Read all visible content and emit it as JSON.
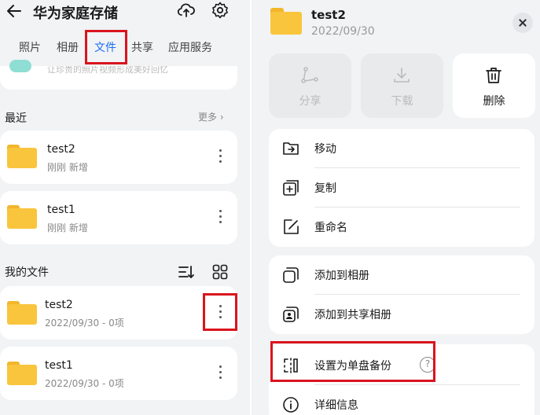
{
  "header": {
    "title": "华为家庭存储"
  },
  "tabs": [
    {
      "label": "照片",
      "active": false
    },
    {
      "label": "相册",
      "active": false
    },
    {
      "label": "文件",
      "active": true
    },
    {
      "label": "共享",
      "active": false
    },
    {
      "label": "应用服务",
      "active": false
    }
  ],
  "banner": {
    "text": "让珍贵的照片视频形成美好回忆"
  },
  "recent": {
    "title": "最近",
    "more_label": "更多",
    "items": [
      {
        "name": "test2",
        "meta": "刚刚 新增"
      },
      {
        "name": "test1",
        "meta": "刚刚 新增"
      }
    ]
  },
  "my_files": {
    "title": "我的文件",
    "items": [
      {
        "name": "test2",
        "meta": "2022/09/30 - 0项"
      },
      {
        "name": "test1",
        "meta": "2022/09/30 - 0项"
      }
    ]
  },
  "sheet": {
    "title": "test2",
    "date": "2022/09/30",
    "actions": [
      {
        "label": "分享",
        "enabled": false
      },
      {
        "label": "下载",
        "enabled": false
      },
      {
        "label": "删除",
        "enabled": true
      }
    ],
    "menu_group_1": [
      {
        "label": "移动"
      },
      {
        "label": "复制"
      },
      {
        "label": "重命名"
      }
    ],
    "menu_group_2": [
      {
        "label": "添加到相册"
      },
      {
        "label": "添加到共享相册"
      }
    ],
    "menu_group_3": [
      {
        "label": "设置为单盘备份",
        "help": "?"
      },
      {
        "label": "详细信息"
      }
    ]
  },
  "colors": {
    "accent": "#1a6ef5",
    "highlight": "#d9141e",
    "folder": "#f9c53c"
  }
}
